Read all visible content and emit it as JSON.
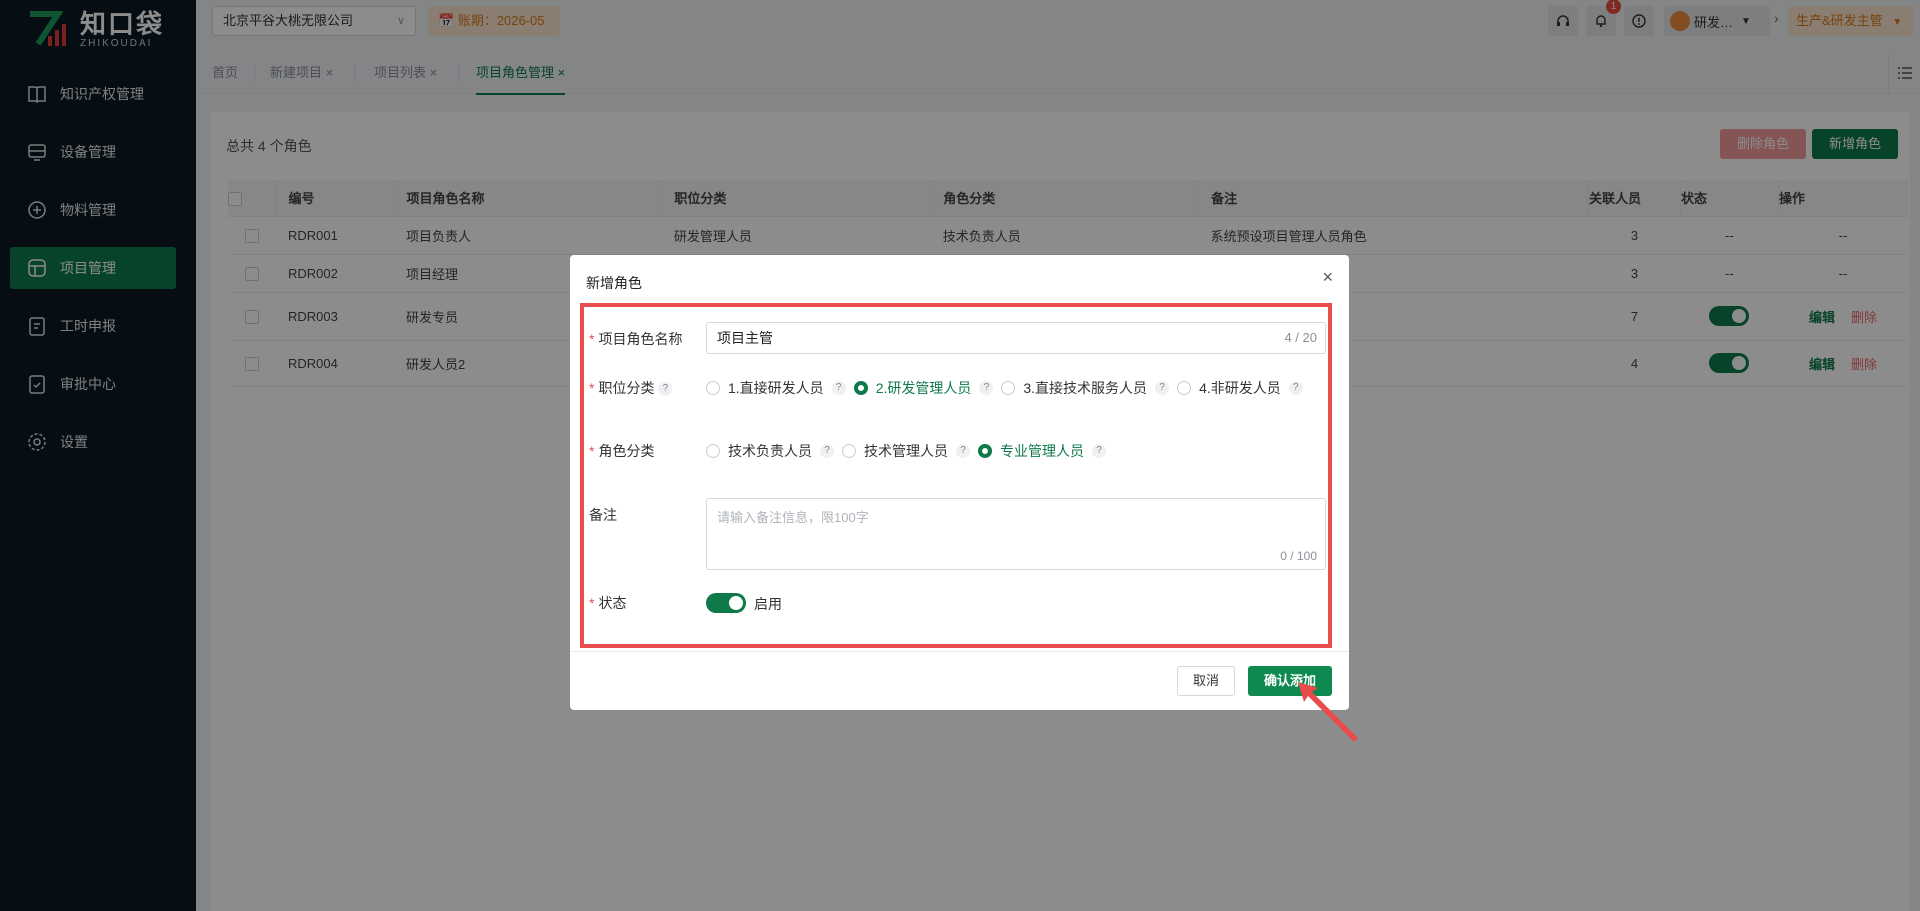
{
  "brand": {
    "name_cn": "知口袋",
    "name_en": "ZHIKOUDAI"
  },
  "sidebar": {
    "items": [
      {
        "label": "知识产权管理",
        "icon": "book-icon"
      },
      {
        "label": "设备管理",
        "icon": "device-icon"
      },
      {
        "label": "物料管理",
        "icon": "box-icon"
      },
      {
        "label": "项目管理",
        "icon": "project-icon",
        "active": true
      },
      {
        "label": "工时申报",
        "icon": "clipboard-icon"
      },
      {
        "label": "审批中心",
        "icon": "approval-icon"
      },
      {
        "label": "设置",
        "icon": "gear-icon"
      }
    ]
  },
  "topbar": {
    "company": "北京平谷大桃无限公司",
    "period": "账期：2026-05",
    "notification_count": "1",
    "user": "研发…",
    "role": "生产&研发主管"
  },
  "tabs": [
    {
      "label": "首页"
    },
    {
      "label": "新建项目",
      "close": "×"
    },
    {
      "label": "项目列表",
      "close": "×"
    },
    {
      "label": "项目角色管理",
      "close": "×",
      "active": true
    }
  ],
  "main": {
    "total": "总共 4 个角色",
    "delete_button": "删除角色",
    "add_button": "新增角色",
    "columns": [
      "编号",
      "项目角色名称",
      "职位分类",
      "角色分类",
      "备注",
      "关联人员",
      "状态",
      "操作"
    ],
    "rows": [
      {
        "id": "RDR001",
        "name": "项目负责人",
        "position": "研发管理人员",
        "role_class": "技术负责人员",
        "note": "系统预设项目管理人员角色",
        "count": "3",
        "status": "--",
        "ops": "--"
      },
      {
        "id": "RDR002",
        "name": "项目经理",
        "position": "",
        "role_class": "",
        "note": "",
        "count": "3",
        "status": "--",
        "ops": "--"
      },
      {
        "id": "RDR003",
        "name": "研发专员",
        "position": "",
        "role_class": "",
        "note": "",
        "count": "7",
        "status": "on",
        "edit": "编辑",
        "delete": "删除"
      },
      {
        "id": "RDR004",
        "name": "研发人员2",
        "position": "",
        "role_class": "",
        "note": "",
        "count": "4",
        "status": "on",
        "edit": "编辑",
        "delete": "删除"
      }
    ]
  },
  "modal": {
    "title": "新增角色",
    "close": "×",
    "name_label": "项目角色名称",
    "name_value": "项目主管",
    "name_count": "4 / 20",
    "position_label": "职位分类",
    "position_help": "?",
    "position_options": [
      "1.直接研发人员",
      "2.研发管理人员",
      "3.直接技术服务人员",
      "4.非研发人员"
    ],
    "position_selected": 1,
    "role_label": "角色分类",
    "role_options": [
      "技术负责人员",
      "技术管理人员",
      "专业管理人员"
    ],
    "role_selected": 2,
    "note_label": "备注",
    "note_placeholder": "请输入备注信息，限100字",
    "note_count": "0 / 100",
    "status_label": "状态",
    "status_value": "启用",
    "cancel": "取消",
    "confirm": "确认添加"
  },
  "colors": {
    "accent": "#0e7a4a",
    "highlight": "#e84c4c",
    "sidebar": "#0b1a24"
  }
}
